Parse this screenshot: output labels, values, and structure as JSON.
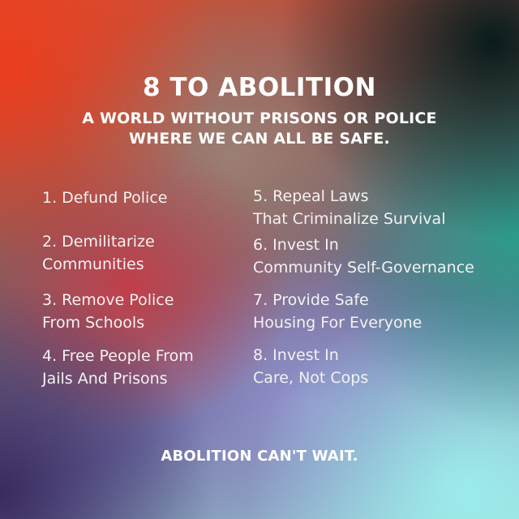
{
  "title": "8 TO ABOLITION",
  "subtitle": {
    "line1": "A WORLD WITHOUT PRISONS OR POLICE",
    "line2": "WHERE WE CAN ALL BE SAFE."
  },
  "demands": {
    "left": [
      {
        "line1": "1. Defund Police",
        "line2": ""
      },
      {
        "line1": "2. Demilitarize",
        "line2": "Communities"
      },
      {
        "line1": "3. Remove Police",
        "line2": "From Schools"
      },
      {
        "line1": "4. Free People From",
        "line2": "Jails And Prisons"
      }
    ],
    "right": [
      {
        "line1": "5. Repeal Laws",
        "line2": "That Criminalize Survival"
      },
      {
        "line1": "6. Invest In",
        "line2": "Community Self-Governance"
      },
      {
        "line1": "7. Provide Safe",
        "line2": "Housing For Everyone"
      },
      {
        "line1": "8. Invest In",
        "line2": "Care, Not Cops"
      }
    ]
  },
  "footer": "ABOLITION CAN'T WAIT.",
  "colors": {
    "top_left": "#ec3a1c",
    "top_right": "#081a1a",
    "mid_right": "#2896a0",
    "bottom_right": "#96ebeb",
    "bottom_left": "#37285a",
    "text": "#ffffff"
  }
}
